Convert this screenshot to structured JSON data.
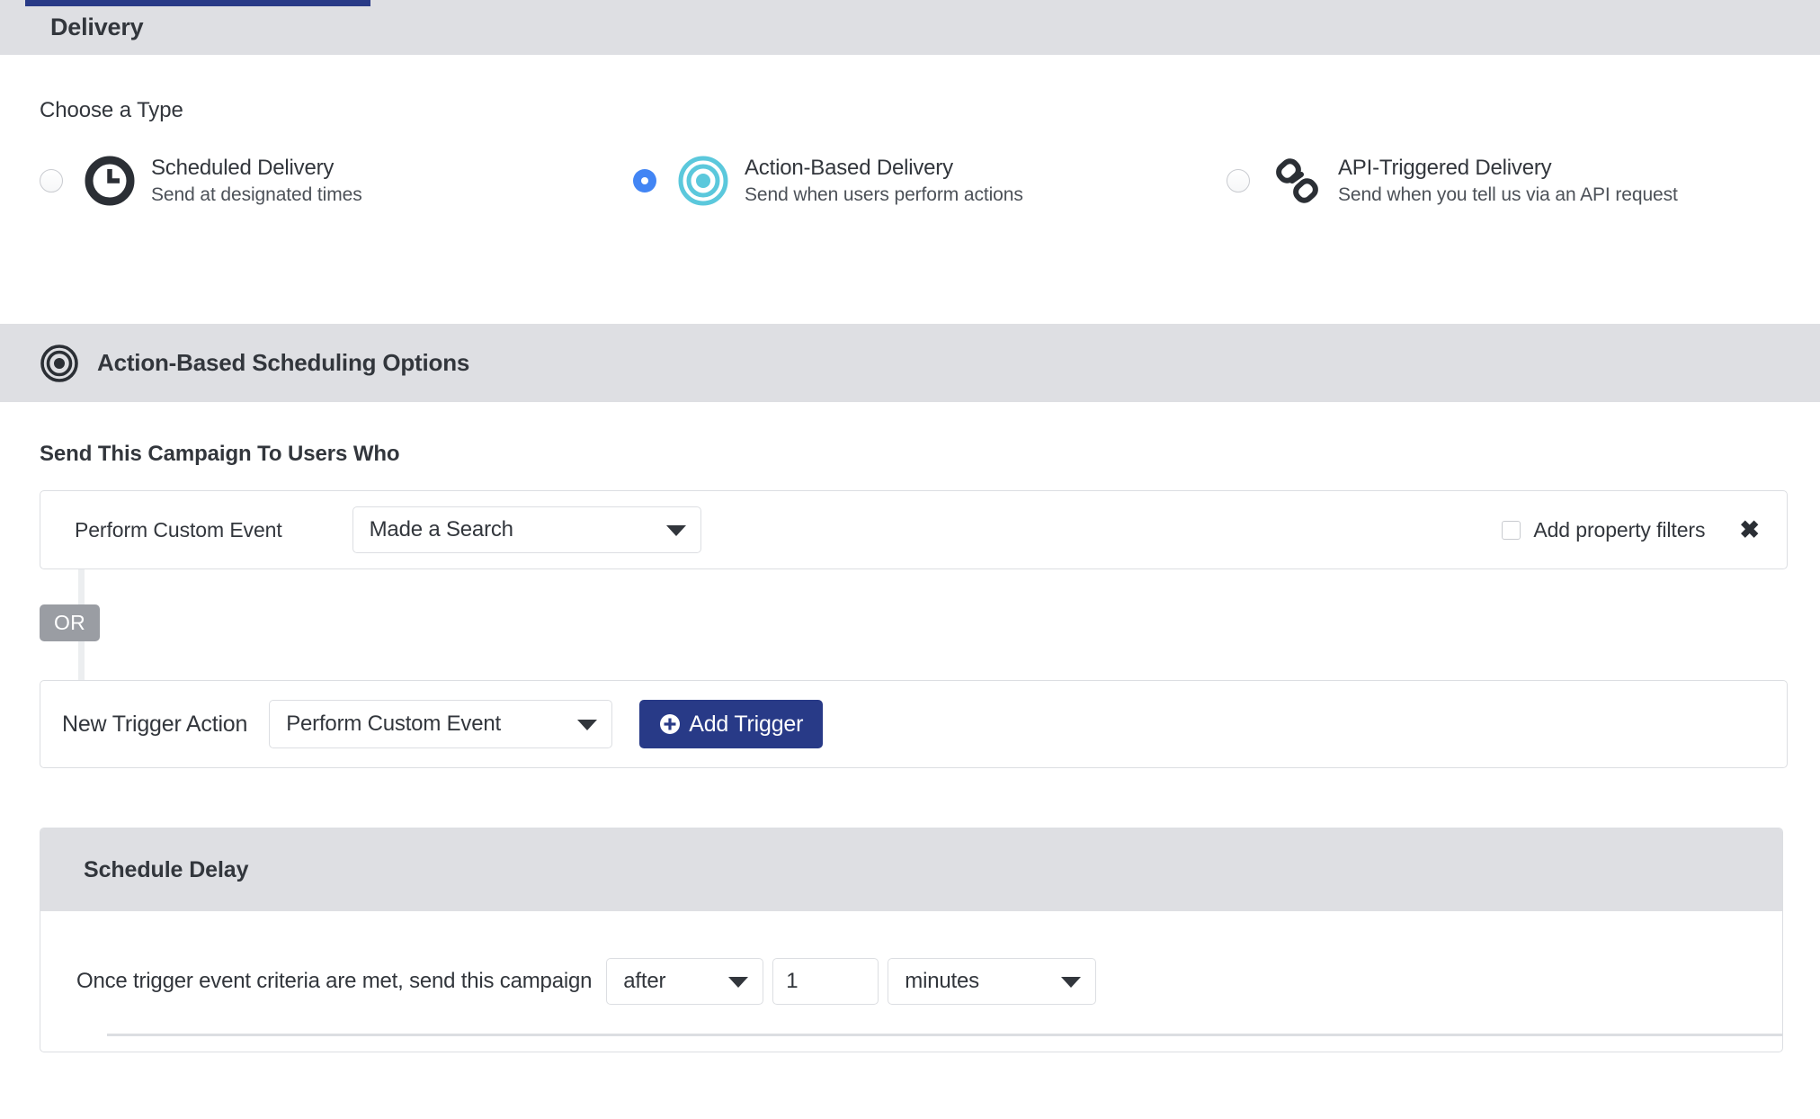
{
  "header": {
    "title": "Delivery",
    "tab_indicator_color": "#283a87"
  },
  "choose_type": {
    "label": "Choose a Type",
    "options": [
      {
        "icon": "clock-icon",
        "title": "Scheduled Delivery",
        "subtitle": "Send at designated times",
        "selected": false
      },
      {
        "icon": "target-icon",
        "title": "Action-Based Delivery",
        "subtitle": "Send when users perform actions",
        "selected": true
      },
      {
        "icon": "chain-link-icon",
        "title": "API-Triggered Delivery",
        "subtitle": "Send when you tell us via an API request",
        "selected": false
      }
    ]
  },
  "scheduling_section": {
    "icon": "target-icon",
    "title": "Action-Based Scheduling Options"
  },
  "triggers": {
    "heading": "Send This Campaign To Users Who",
    "row": {
      "label": "Perform Custom Event",
      "event_select_value": "Made a Search",
      "filters_checkbox_label": "Add property filters",
      "filters_checked": false,
      "remove_icon": "close-icon"
    },
    "or_badge": "OR",
    "new_trigger": {
      "label": "New Trigger Action",
      "action_select_value": "Perform Custom Event",
      "add_button_label": "Add Trigger",
      "add_button_icon": "plus-circle-icon",
      "add_button_color": "#283a87"
    }
  },
  "schedule_delay": {
    "title": "Schedule Delay",
    "sentence": "Once trigger event criteria are met, send this campaign",
    "when_select_value": "after",
    "amount_value": "1",
    "unit_select_value": "minutes"
  },
  "colors": {
    "band_gray": "#dedfe3",
    "accent_navy": "#283a87",
    "radio_blue": "#4285f4",
    "target_teal": "#5bc8dc",
    "or_gray": "#9a9da3"
  }
}
